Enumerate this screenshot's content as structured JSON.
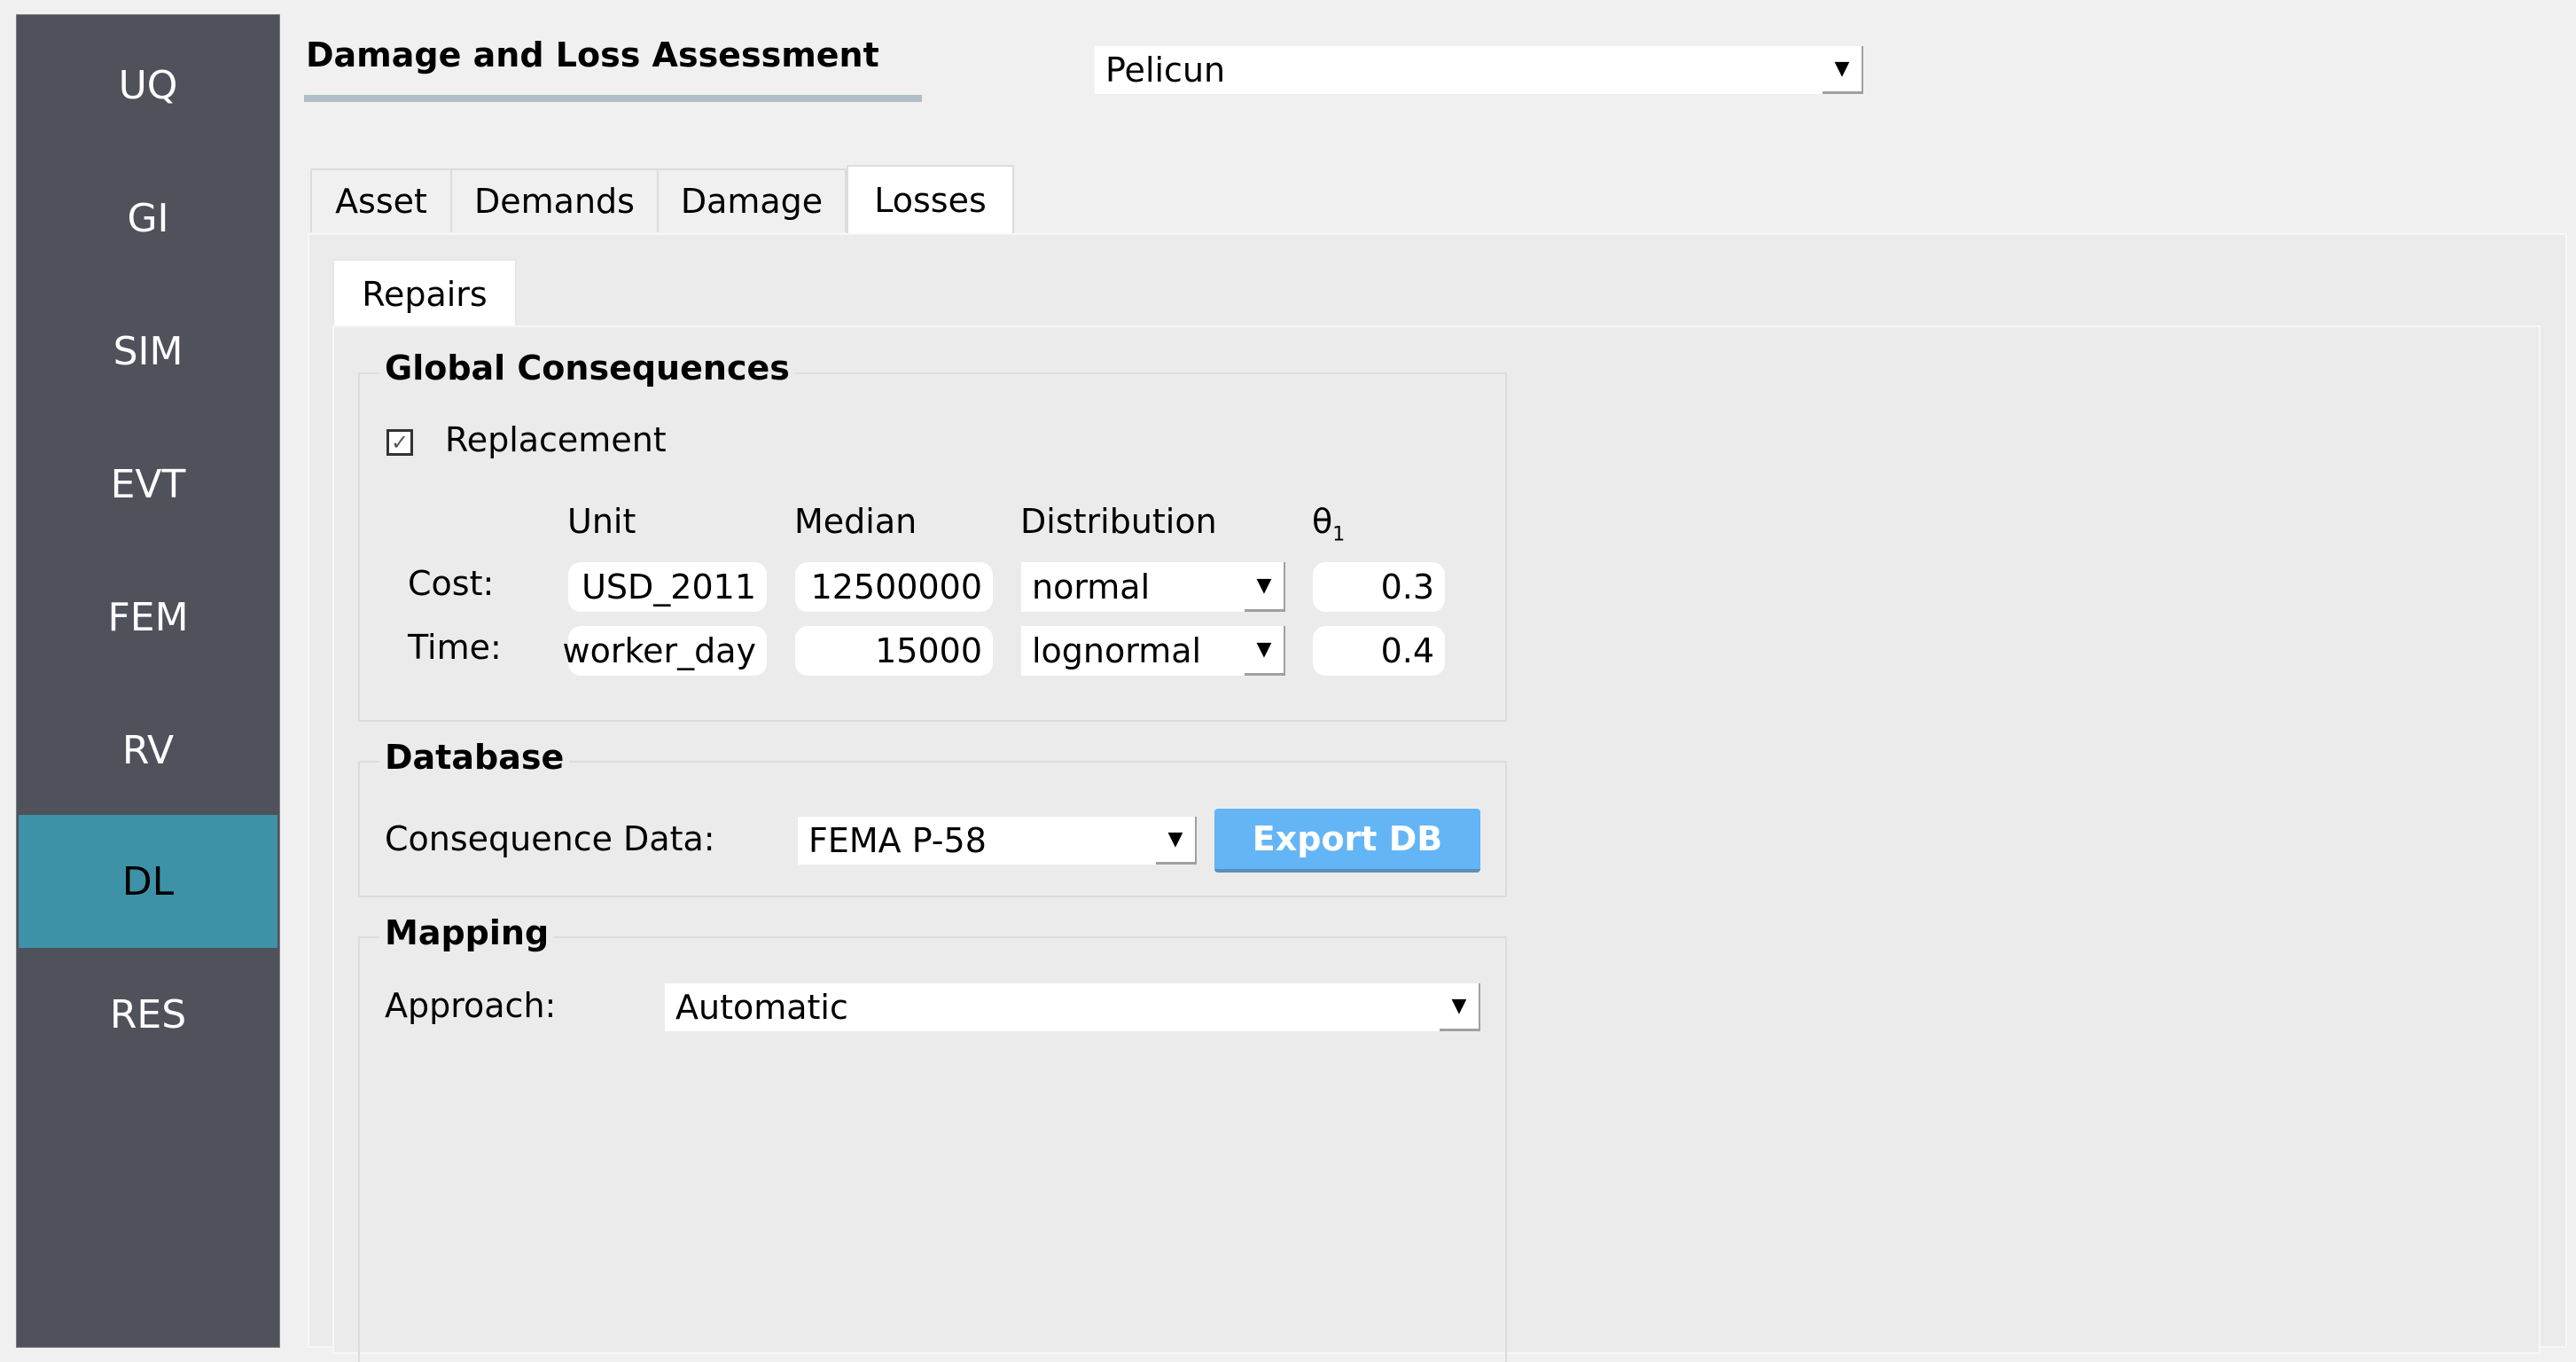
{
  "sidebar": {
    "items": [
      {
        "label": "UQ",
        "active": false
      },
      {
        "label": "GI",
        "active": false
      },
      {
        "label": "SIM",
        "active": false
      },
      {
        "label": "EVT",
        "active": false
      },
      {
        "label": "FEM",
        "active": false
      },
      {
        "label": "RV",
        "active": false
      },
      {
        "label": "DL",
        "active": true
      },
      {
        "label": "RES",
        "active": false
      }
    ],
    "active_color": "#3e92a8"
  },
  "header": {
    "title": "Damage and Loss Assessment",
    "engine_combo": {
      "value": "Pelicun"
    }
  },
  "tabs": [
    {
      "label": "Asset",
      "active": false
    },
    {
      "label": "Demands",
      "active": false
    },
    {
      "label": "Damage",
      "active": false
    },
    {
      "label": "Losses",
      "active": true
    }
  ],
  "subtabs": [
    {
      "label": "Repairs",
      "active": true
    }
  ],
  "global_consequences": {
    "title": "Global Consequences",
    "replacement": {
      "label": "Replacement",
      "checked": true,
      "check_glyph": "✓"
    },
    "columns": {
      "unit": "Unit",
      "median": "Median",
      "distribution": "Distribution",
      "theta": "θ",
      "theta_sub": "1"
    },
    "rows": [
      {
        "label": "Cost:",
        "unit": "USD_2011",
        "median": "12500000",
        "distribution": "normal",
        "theta": "0.3"
      },
      {
        "label": "Time:",
        "unit": "worker_day",
        "median": "15000",
        "distribution": "lognormal",
        "theta": "0.4"
      }
    ]
  },
  "database": {
    "title": "Database",
    "consequence_label": "Consequence Data:",
    "consequence_value": "FEMA P-58",
    "export_button": "Export DB",
    "export_color": "#64b5f6"
  },
  "mapping": {
    "title": "Mapping",
    "approach_label": "Approach:",
    "approach_value": "Automatic"
  },
  "icons": {
    "dropdown": "▼"
  }
}
